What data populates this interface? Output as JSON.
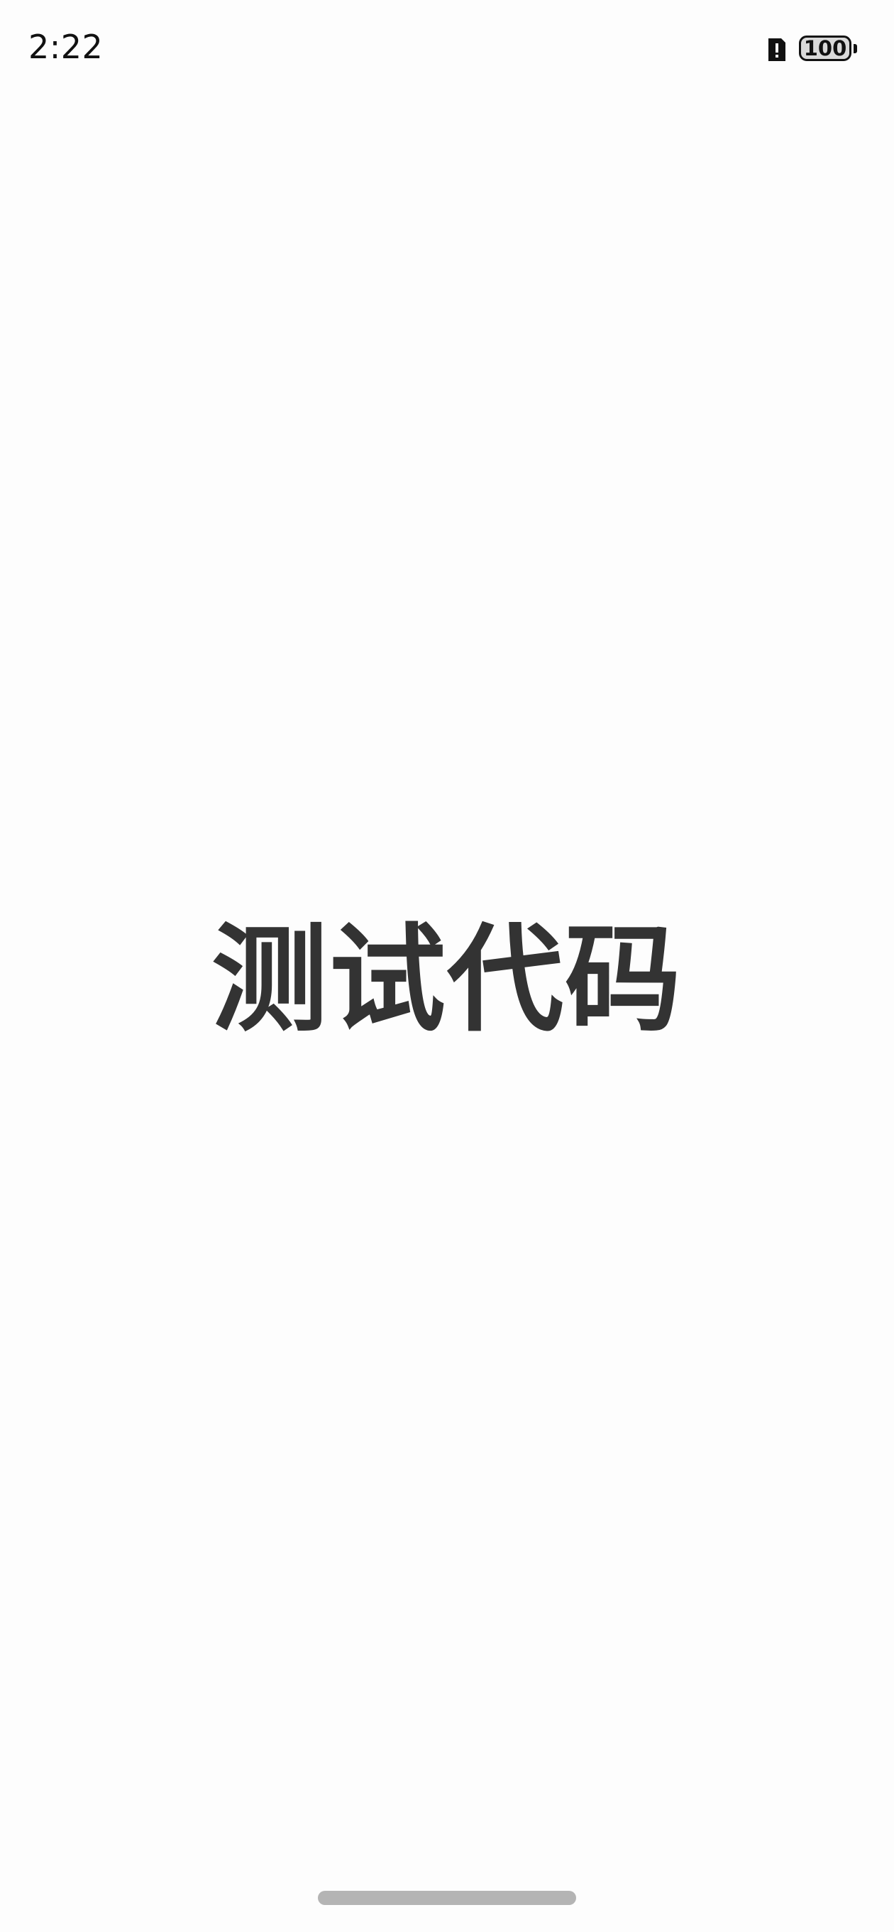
{
  "status_bar": {
    "time": "2:22",
    "battery_level": "100",
    "sim_icon": "sim-alert-icon",
    "battery_icon": "battery-icon"
  },
  "main": {
    "title": "测试代码"
  },
  "colors": {
    "background": "#fdfdfd",
    "title_text": "#333333",
    "home_indicator": "#b4b4b4"
  }
}
